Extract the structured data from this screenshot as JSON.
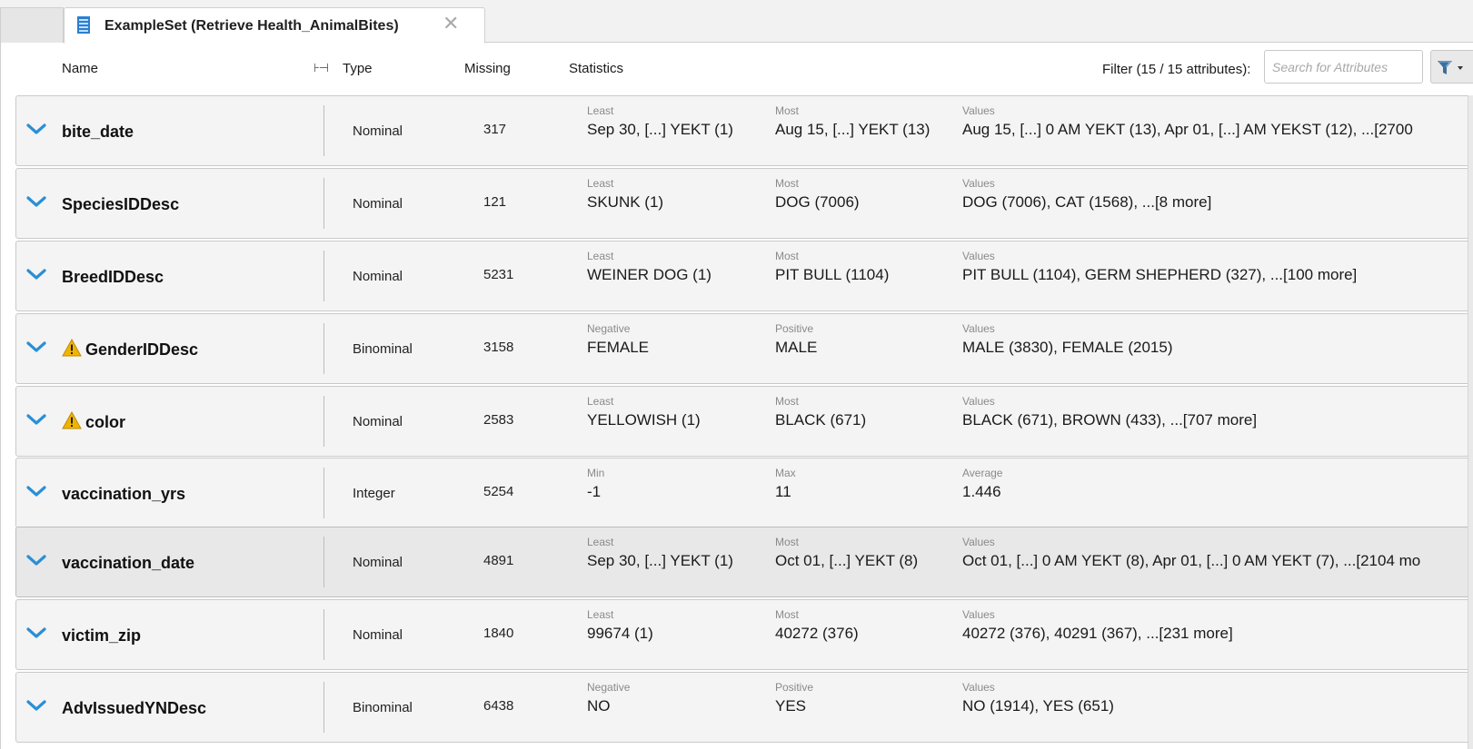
{
  "tab": {
    "title": "ExampleSet (Retrieve Health_AnimalBites)",
    "close_glyph": "✕",
    "icon": "table-icon"
  },
  "header": {
    "name": "Name",
    "type": "Type",
    "missing": "Missing",
    "statistics": "Statistics",
    "resize_glyph": "⊦⊣"
  },
  "filter": {
    "label": "Filter (15 / 15 attributes):",
    "search_placeholder": "Search for Attributes",
    "search_value": "",
    "button_icon": "funnel-dropdown-icon"
  },
  "colors": {
    "chevron": "#2a8fd6",
    "warning": "#f0b400",
    "row_bg": "#f4f4f4",
    "row_selected_bg": "#e8e8e8"
  },
  "rows": [
    {
      "name": "bite_date",
      "warning": false,
      "type": "Nominal",
      "missing": "317",
      "s1_label": "Least",
      "s1_value": "Sep 30,  [...]  YEKT (1)",
      "s2_label": "Most",
      "s2_value": "Aug 15,  [...] YEKT (13)",
      "s3_label": "Values",
      "s3_value": "Aug 15,  [...] 0 AM YEKT (13), Apr 01,  [...]  AM YEKST (12), ...[2700"
    },
    {
      "name": "SpeciesIDDesc",
      "warning": false,
      "type": "Nominal",
      "missing": "121",
      "s1_label": "Least",
      "s1_value": "SKUNK (1)",
      "s2_label": "Most",
      "s2_value": "DOG (7006)",
      "s3_label": "Values",
      "s3_value": "DOG (7006), CAT (1568), ...[8 more]"
    },
    {
      "name": "BreedIDDesc",
      "warning": false,
      "type": "Nominal",
      "missing": "5231",
      "s1_label": "Least",
      "s1_value": "WEINER DOG (1)",
      "s2_label": "Most",
      "s2_value": "PIT BULL (1104)",
      "s3_label": "Values",
      "s3_value": "PIT BULL (1104), GERM SHEPHERD (327), ...[100 more]"
    },
    {
      "name": "GenderIDDesc",
      "warning": true,
      "type": "Binominal",
      "missing": "3158",
      "s1_label": "Negative",
      "s1_value": "FEMALE",
      "s2_label": "Positive",
      "s2_value": "MALE",
      "s3_label": "Values",
      "s3_value": "MALE (3830), FEMALE (2015)"
    },
    {
      "name": "color",
      "warning": true,
      "type": "Nominal",
      "missing": "2583",
      "s1_label": "Least",
      "s1_value": "YELLOWISH (1)",
      "s2_label": "Most",
      "s2_value": "BLACK (671)",
      "s3_label": "Values",
      "s3_value": "BLACK (671), BROWN (433), ...[707 more]"
    },
    {
      "name": "vaccination_yrs",
      "warning": false,
      "type": "Integer",
      "missing": "5254",
      "s1_label": "Min",
      "s1_value": "-1",
      "s2_label": "Max",
      "s2_value": "11",
      "s3_label": "Average",
      "s3_value": "1.446"
    },
    {
      "name": "vaccination_date",
      "warning": false,
      "selected": true,
      "type": "Nominal",
      "missing": "4891",
      "s1_label": "Least",
      "s1_value": "Sep 30,  [...]  YEKT (1)",
      "s2_label": "Most",
      "s2_value": "Oct 01,  [...]  YEKT (8)",
      "s3_label": "Values",
      "s3_value": "Oct 01,  [...] 0 AM YEKT (8), Apr 01,  [...] 0 AM YEKT (7), ...[2104 mo"
    },
    {
      "name": "victim_zip",
      "warning": false,
      "type": "Nominal",
      "missing": "1840",
      "s1_label": "Least",
      "s1_value": "99674 (1)",
      "s2_label": "Most",
      "s2_value": "40272 (376)",
      "s3_label": "Values",
      "s3_value": "40272 (376), 40291 (367), ...[231 more]"
    },
    {
      "name": "AdvIssuedYNDesc",
      "warning": false,
      "type": "Binominal",
      "missing": "6438",
      "s1_label": "Negative",
      "s1_value": "NO",
      "s2_label": "Positive",
      "s2_value": "YES",
      "s3_label": "Values",
      "s3_value": "NO (1914), YES (651)"
    }
  ]
}
